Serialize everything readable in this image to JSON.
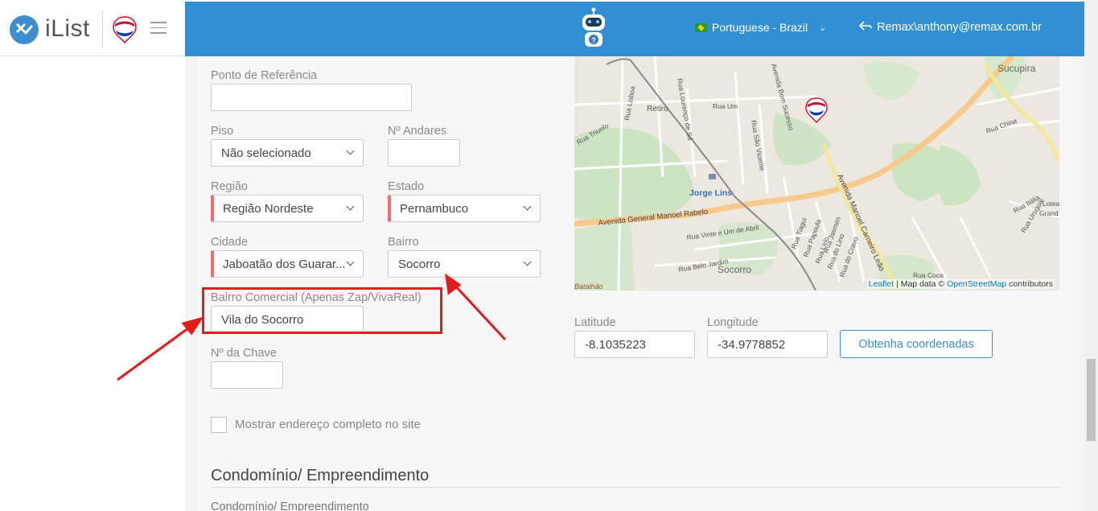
{
  "brand": {
    "name": "iList",
    "menu_icon": "hamburger-icon"
  },
  "header": {
    "language": "Portuguese - Brazil",
    "user": "Remax\\anthony@remax.com.br",
    "accent_color": "#3190d4"
  },
  "form": {
    "ponto_referencia": {
      "label": "Ponto de Referência",
      "value": ""
    },
    "piso": {
      "label": "Piso",
      "value": "Não selecionado"
    },
    "n_andares": {
      "label": "Nº Andares",
      "value": ""
    },
    "regiao": {
      "label": "Região",
      "value": "Região Nordeste"
    },
    "estado": {
      "label": "Estado",
      "value": "Pernambuco"
    },
    "cidade": {
      "label": "Cidade",
      "value": "Jaboatão dos Guarar..."
    },
    "bairro": {
      "label": "Bairro",
      "value": "Socorro"
    },
    "bairro_comercial": {
      "label": "Bairro Comercial (Apenas Zap/VivaReal)",
      "value": "Vila do Socorro"
    },
    "n_chave": {
      "label": "Nº da Chave",
      "value": ""
    },
    "mostrar_endereco": {
      "label": "Mostrar endereço completo no site",
      "checked": false
    },
    "latitude": {
      "label": "Latitude",
      "value": "-8.1035223"
    },
    "longitude": {
      "label": "Longitude",
      "value": "-34.9778852"
    },
    "get_coords_button": "Obtenha coordenadas"
  },
  "section": {
    "title": "Condomínio/ Empreendimento",
    "first_field_label": "Condomínio/ Empreendimento"
  },
  "map": {
    "attribution_leaflet": "Leaflet",
    "attribution_sep": "| Map data ©",
    "attribution_osm": "OpenStreetMap",
    "attribution_tail": "contributors",
    "labels": {
      "sucupira": "Sucupira",
      "retiro": "Retiro",
      "jorge_lins": "Jorge Lins",
      "av_general": "Avenida General Manoel Rabelo",
      "av_manoel": "Avenida Manoel Carneiro Leão",
      "socorro": "Socorro",
      "batalhao": "Batalhão",
      "rua_um": "Rua Um",
      "rua_sao_vicente": "Rua São Vicente",
      "rua_vinte": "Rua Vinte e Um de Abril",
      "rua_belo_jardim": "Rua Belo Jardim",
      "rua_lisboa": "Rua Lisboa",
      "rua_triunfo": "Rua Triunfo",
      "rua_china": "Rua China",
      "rua_italia": "Rua Itália",
      "rua_uruguai": "Rua Uruguai",
      "rua_coca": "Rua Coca",
      "rua_lino": "Rua do Lino",
      "rua_cravo": "Rua do Cravo",
      "rua_papoula": "Rua Papoula",
      "rua_tiagui": "Rua Tiagui",
      "rua_lirio": "Rua Lírio",
      "rua_jasmim": "Rua Jasmim",
      "rua_bom_sucesso": "Avenida Bom Sucesso",
      "rua_lourenco": "Rua Lourenço de Sá",
      "rua_lotea": "Lotea",
      "rua_grand": "Grand"
    }
  }
}
